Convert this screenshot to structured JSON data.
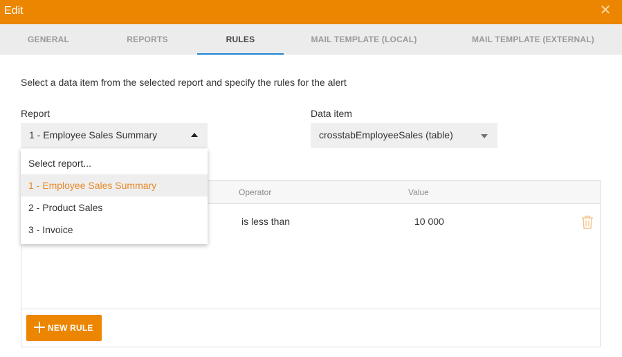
{
  "window": {
    "title": "Edit",
    "close_icon": "close-icon"
  },
  "tabs": [
    {
      "label": "GENERAL",
      "active": false
    },
    {
      "label": "REPORTS",
      "active": false
    },
    {
      "label": "RULES",
      "active": true
    },
    {
      "label": "MAIL TEMPLATE (LOCAL)",
      "active": false
    },
    {
      "label": "MAIL TEMPLATE (EXTERNAL)",
      "active": false
    }
  ],
  "instruction": "Select a data item from the selected report and specify the rules for the alert",
  "report": {
    "label": "Report",
    "selected": "1 - Employee Sales Summary",
    "options": [
      "Select report...",
      "1 - Employee Sales Summary",
      "2 - Product Sales",
      "3 - Invoice"
    ]
  },
  "data_item": {
    "label": "Data item",
    "selected": "crosstabEmployeeSales (table)"
  },
  "rules_table": {
    "columns": {
      "operator": "Operator",
      "value": "Value"
    },
    "rows": [
      {
        "operator": "is less than",
        "value": "10 000",
        "delete_icon": "trash-icon"
      }
    ]
  },
  "new_rule_button": "NEW RULE",
  "colors": {
    "accent": "#ec8500",
    "tab_underline": "#1f86d1",
    "selected_option_text": "#e8892a"
  }
}
